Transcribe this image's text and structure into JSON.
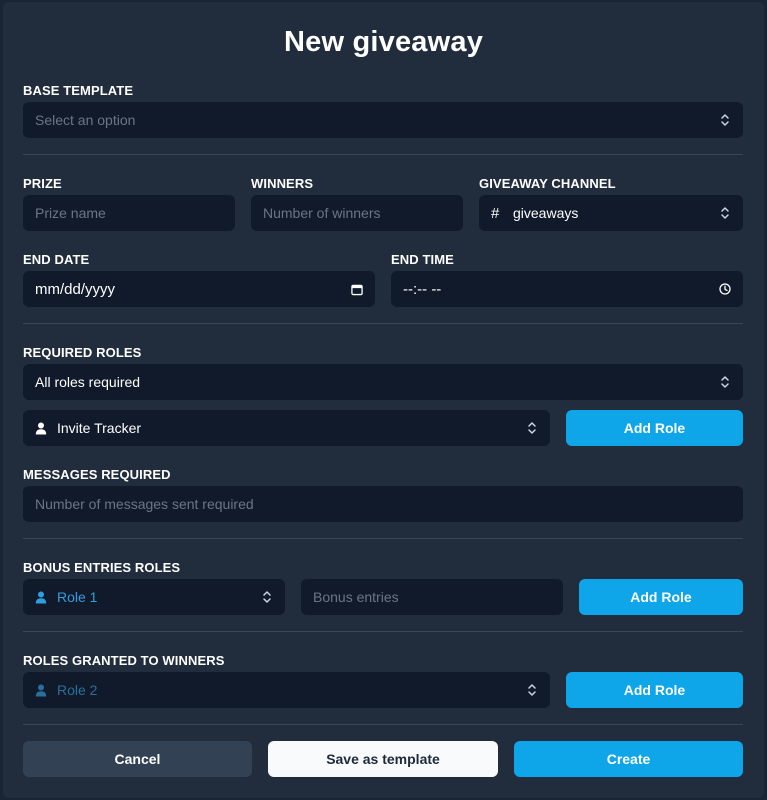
{
  "dialog": {
    "title": "New giveaway"
  },
  "base_template": {
    "label": "BASE TEMPLATE",
    "placeholder": "Select an option",
    "icon": "updown-chevron-icon"
  },
  "prize": {
    "label": "PRIZE",
    "placeholder": "Prize name"
  },
  "winners": {
    "label": "WINNERS",
    "placeholder": "Number of winners"
  },
  "channel": {
    "label": "GIVEAWAY CHANNEL",
    "prefix": "#",
    "value": "giveaways"
  },
  "end_date": {
    "label": "END DATE",
    "value": "mm/dd/yyyy",
    "icon": "calendar-icon"
  },
  "end_time": {
    "label": "END TIME",
    "value": "--:-- --",
    "icon": "clock-icon"
  },
  "required_roles": {
    "label": "REQUIRED ROLES",
    "mode": "All roles required",
    "role": "Invite Tracker",
    "add_label": "Add Role"
  },
  "messages_required": {
    "label": "MESSAGES REQUIRED",
    "placeholder": "Number of messages sent required"
  },
  "bonus_entries": {
    "label": "BONUS ENTRIES ROLES",
    "role": "Role 1",
    "entries_placeholder": "Bonus entries",
    "add_label": "Add Role"
  },
  "winner_roles": {
    "label": "ROLES GRANTED TO WINNERS",
    "role": "Role 2",
    "add_label": "Add Role"
  },
  "footer": {
    "cancel": "Cancel",
    "save_template": "Save as template",
    "create": "Create"
  },
  "colors": {
    "background": "#212c3d",
    "input": "#111a2a",
    "primary": "#0ea5e9",
    "secondary": "#334155",
    "accent_text": "#2f9ee0"
  }
}
